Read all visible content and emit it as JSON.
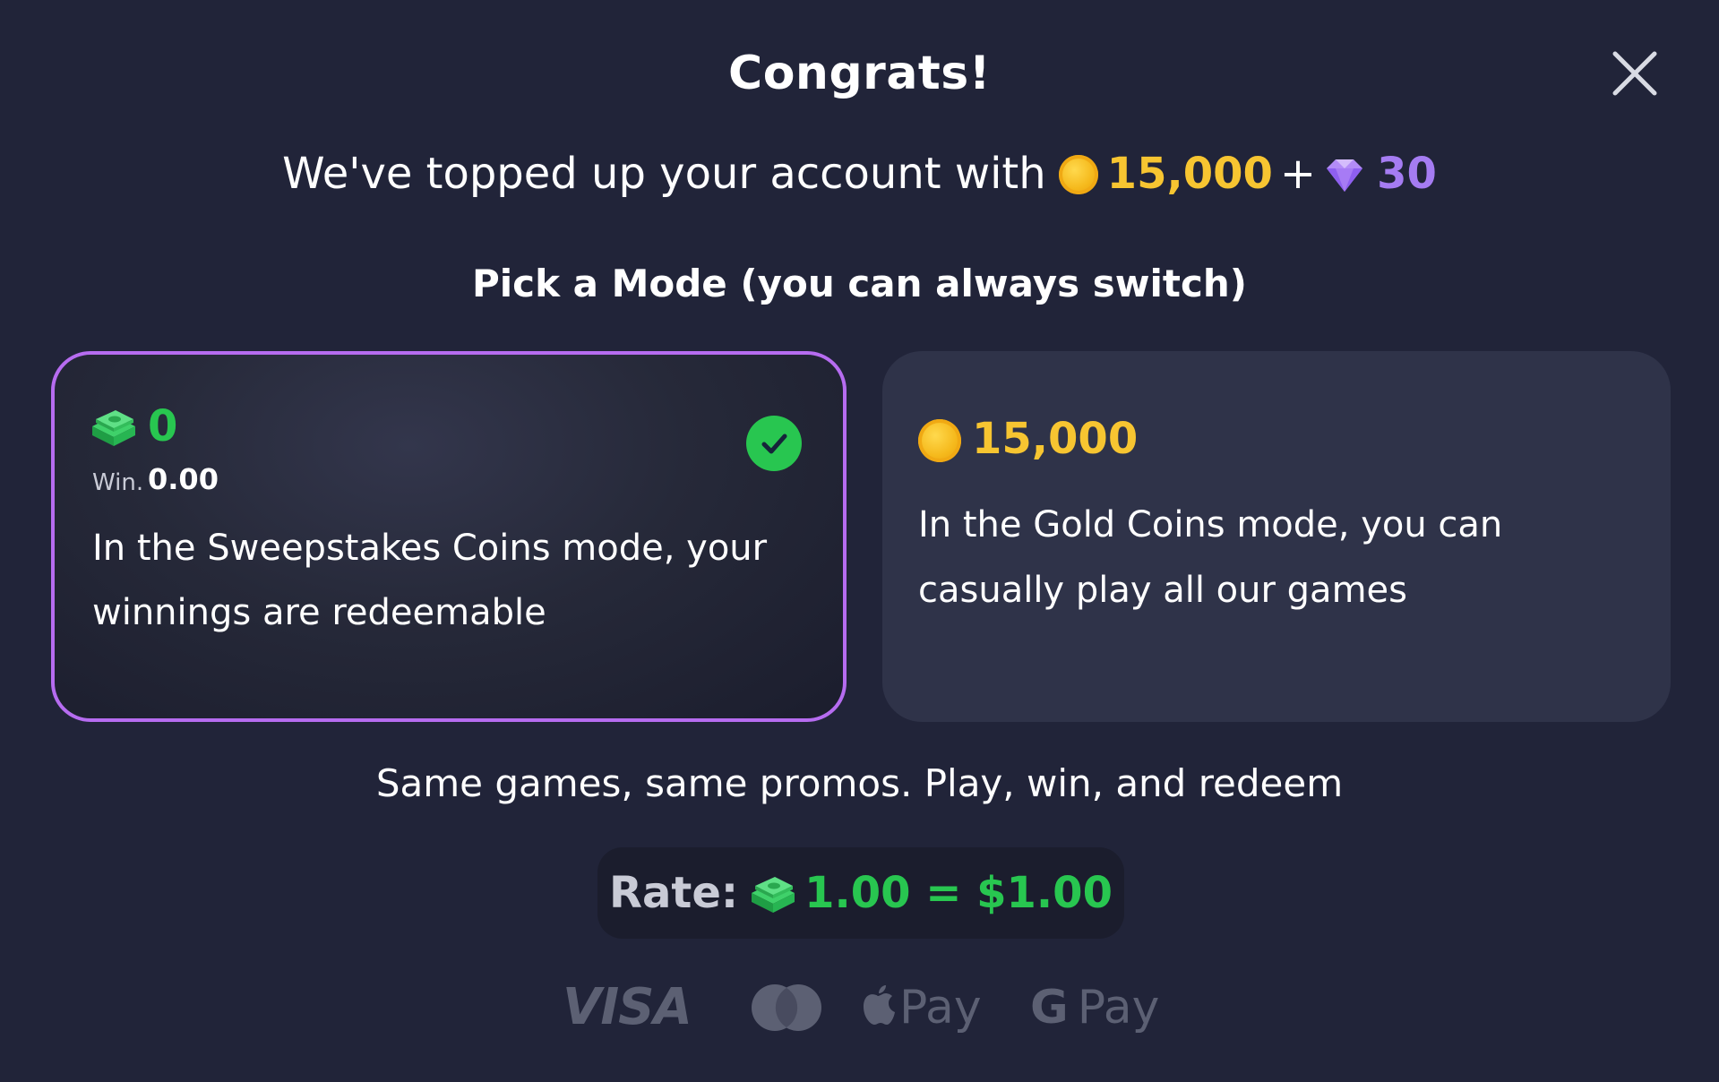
{
  "dialog": {
    "title": "Congrats!",
    "close_icon": "close-icon"
  },
  "topup": {
    "prefix": "We've topped up your account with",
    "gold_amount": "15,000",
    "plus": "+",
    "gem_amount": "30"
  },
  "pick_mode": {
    "label": "Pick a Mode (you can always switch)"
  },
  "modes": {
    "sweepstakes": {
      "amount": "0",
      "win_label": "Win.",
      "win_value": "0.00",
      "description": "In the Sweepstakes Coins mode, your winnings are redeemable",
      "selected": true
    },
    "gold": {
      "amount": "15,000",
      "description": "In the Gold Coins mode, you can casually play all our games",
      "selected": false
    }
  },
  "tagline": "Same games, same promos. Play, win, and redeem",
  "rate": {
    "label": "Rate:",
    "value": "1.00 = $1.00"
  },
  "payments": {
    "visa": "VISA",
    "apple_pay": "Pay",
    "google_g": "G",
    "google_pay": "Pay"
  },
  "colors": {
    "background": "#212439",
    "card_selected_border": "#b66cf0",
    "card_bg": "#2f3349",
    "sweeps_green": "#28c650",
    "gold": "#f7c531",
    "gem_purple": "#a57cf2",
    "muted": "#5c6073"
  }
}
